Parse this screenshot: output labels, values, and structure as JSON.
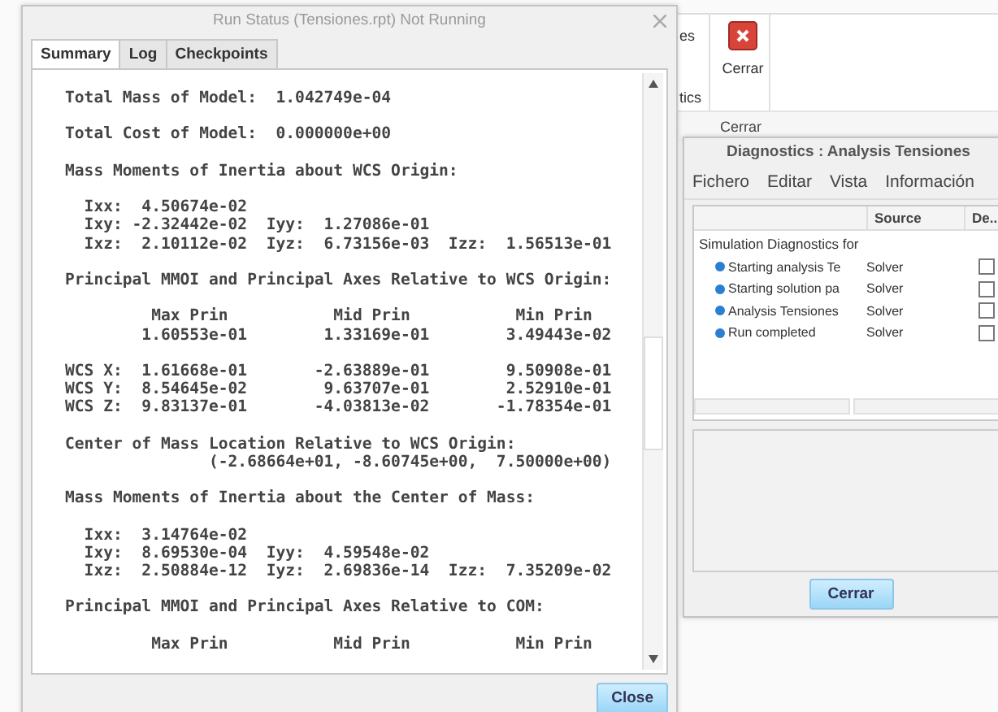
{
  "background_app": {
    "ribbon_fragments": [
      "es",
      "tics"
    ],
    "close_command": {
      "label": "Cerrar"
    },
    "group_label": "Cerrar"
  },
  "run_status_window": {
    "title": "Run Status (Tensiones.rpt) Not Running",
    "tabs": [
      {
        "label": "Summary",
        "selected": true
      },
      {
        "label": "Log",
        "selected": false
      },
      {
        "label": "Checkpoints",
        "selected": false
      }
    ],
    "report": [
      [
        "Total Mass of Model:  1.042749e-04"
      ],
      [
        "Total Cost of Model:  0.000000e+00"
      ],
      [
        "Mass Moments of Inertia about WCS Origin:"
      ],
      [
        "  Ixx:  4.50674e-02",
        "  Ixy: -2.32442e-02  Iyy:  1.27086e-01",
        "  Ixz:  2.10112e-02  Iyz:  6.73156e-03  Izz:  1.56513e-01"
      ],
      [
        "Principal MMOI and Principal Axes Relative to WCS Origin:"
      ],
      [
        "         Max Prin           Mid Prin           Min Prin",
        "        1.60553e-01        1.33169e-01        3.49443e-02"
      ],
      [
        "WCS X:  1.61668e-01       -2.63889e-01        9.50908e-01",
        "WCS Y:  8.54645e-02        9.63707e-01        2.52910e-01",
        "WCS Z:  9.83137e-01       -4.03813e-02       -1.78354e-01"
      ],
      [
        "Center of Mass Location Relative to WCS Origin:",
        "               (-2.68664e+01, -8.60745e+00,  7.50000e+00)"
      ],
      [
        "Mass Moments of Inertia about the Center of Mass:"
      ],
      [
        "  Ixx:  3.14764e-02",
        "  Ixy:  8.69530e-04  Iyy:  4.59548e-02",
        "  Ixz:  2.50884e-12  Iyz:  2.69836e-14  Izz:  7.35209e-02"
      ],
      [
        "Principal MMOI and Principal Axes Relative to COM:"
      ],
      [
        "         Max Prin           Mid Prin           Min Prin"
      ]
    ],
    "close_button": "Close"
  },
  "diagnostics_window": {
    "title": "Diagnostics : Analysis Tensiones",
    "menu": [
      "Fichero",
      "Editar",
      "Vista",
      "Información"
    ],
    "columns": [
      "Source",
      "De..."
    ],
    "tree": [
      {
        "label": "Simulation Diagnostics for",
        "children": [
          {
            "label": "Starting analysis Te",
            "source": "Solver",
            "checked": false
          },
          {
            "label": "Starting solution pa",
            "source": "Solver",
            "checked": false
          },
          {
            "label": "Analysis Tensiones",
            "source": "Solver",
            "checked": false
          },
          {
            "label": "Run completed",
            "source": "Solver",
            "checked": false
          }
        ]
      }
    ],
    "close_button": "Cerrar"
  }
}
